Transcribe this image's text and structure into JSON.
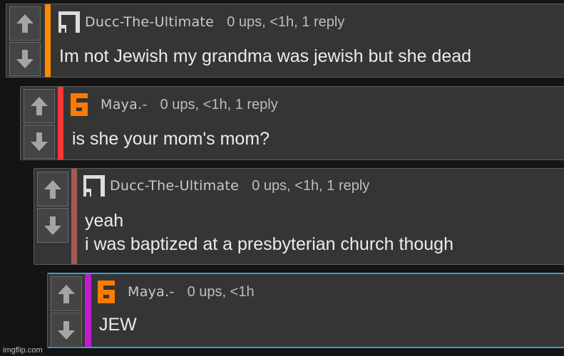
{
  "comments": [
    {
      "username": "Ducc-The-Ultimate",
      "meta": "0 ups, <1h, 1 reply",
      "lines": [
        "Im not Jewish my grandma was jewish but she dead"
      ],
      "bar_color": "#ff8a00",
      "avatar": "ducc-avatar-icon"
    },
    {
      "username": "Maya.-",
      "meta": "0 ups, <1h, 1 reply",
      "lines": [
        "is she your mom's mom?"
      ],
      "bar_color": "#ff3636",
      "avatar": "maya-avatar-icon"
    },
    {
      "username": "Ducc-The-Ultimate",
      "meta": "0 ups, <1h, 1 reply",
      "lines": [
        "yeah",
        "i was baptized at a presbyterian church though"
      ],
      "bar_color": "#a25a55",
      "avatar": "ducc-avatar-icon"
    },
    {
      "username": "Maya.-",
      "meta": "0 ups, <1h",
      "lines": [
        "JEW"
      ],
      "bar_color": "#c21bd0",
      "avatar": "maya-avatar-icon",
      "highlight_border": "#2aa4d8"
    }
  ],
  "icons": {
    "upvote": "up-arrow-icon",
    "downvote": "down-arrow-icon"
  },
  "watermark": "imgflip.com"
}
